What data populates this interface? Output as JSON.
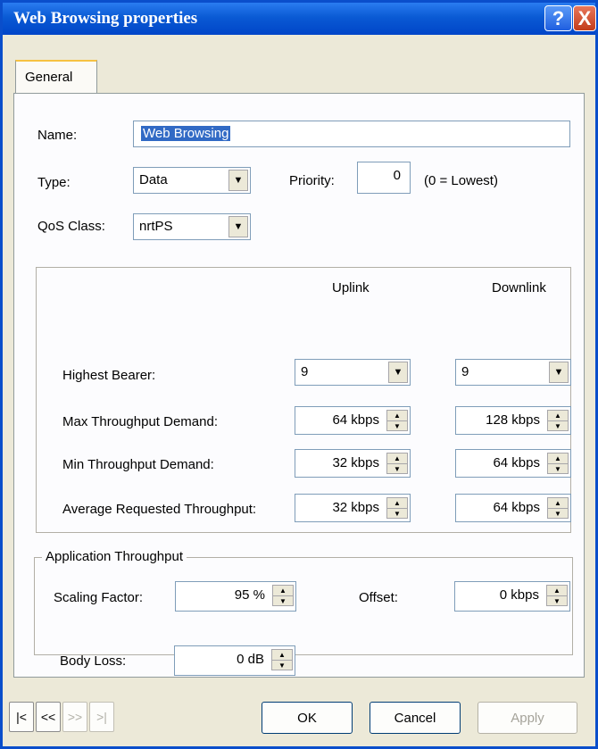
{
  "window": {
    "title": "Web Browsing properties",
    "help_glyph": "?",
    "close_glyph": "X"
  },
  "tabs": [
    {
      "label": "General"
    }
  ],
  "general": {
    "name_label": "Name:",
    "name_value": "Web Browsing",
    "type_label": "Type:",
    "type_value": "Data",
    "priority_label": "Priority:",
    "priority_value": "0",
    "priority_hint": "(0 = Lowest)",
    "qos_label": "QoS Class:",
    "qos_value": "nrtPS"
  },
  "throughput_table": {
    "uplink_header": "Uplink",
    "downlink_header": "Downlink",
    "rows": [
      {
        "label": "Highest Bearer:",
        "uplink": "9",
        "downlink": "9"
      },
      {
        "label": "Max Throughput Demand:",
        "uplink": "64 kbps",
        "downlink": "128 kbps"
      },
      {
        "label": "Min Throughput Demand:",
        "uplink": "32 kbps",
        "downlink": "64 kbps"
      },
      {
        "label": "Average Requested Throughput:",
        "uplink": "32 kbps",
        "downlink": "64 kbps"
      }
    ]
  },
  "app_throughput": {
    "title": "Application Throughput",
    "scaling_label": "Scaling Factor:",
    "scaling_value": "95 %",
    "offset_label": "Offset:",
    "offset_value": "0 kbps"
  },
  "body_loss": {
    "label": "Body Loss:",
    "value": "0 dB"
  },
  "footer": {
    "nav": [
      "|<",
      "<<",
      ">>",
      ">|"
    ],
    "ok_label": "OK",
    "cancel_label": "Cancel",
    "apply_label": "Apply"
  },
  "icons": {
    "dropdown": "chevron-down-icon",
    "spinner": "spin-arrows-icon"
  },
  "colors": {
    "titlebar": "#0a5ad4",
    "selection": "#316ac5",
    "tab_highlight": "#f6c243"
  }
}
